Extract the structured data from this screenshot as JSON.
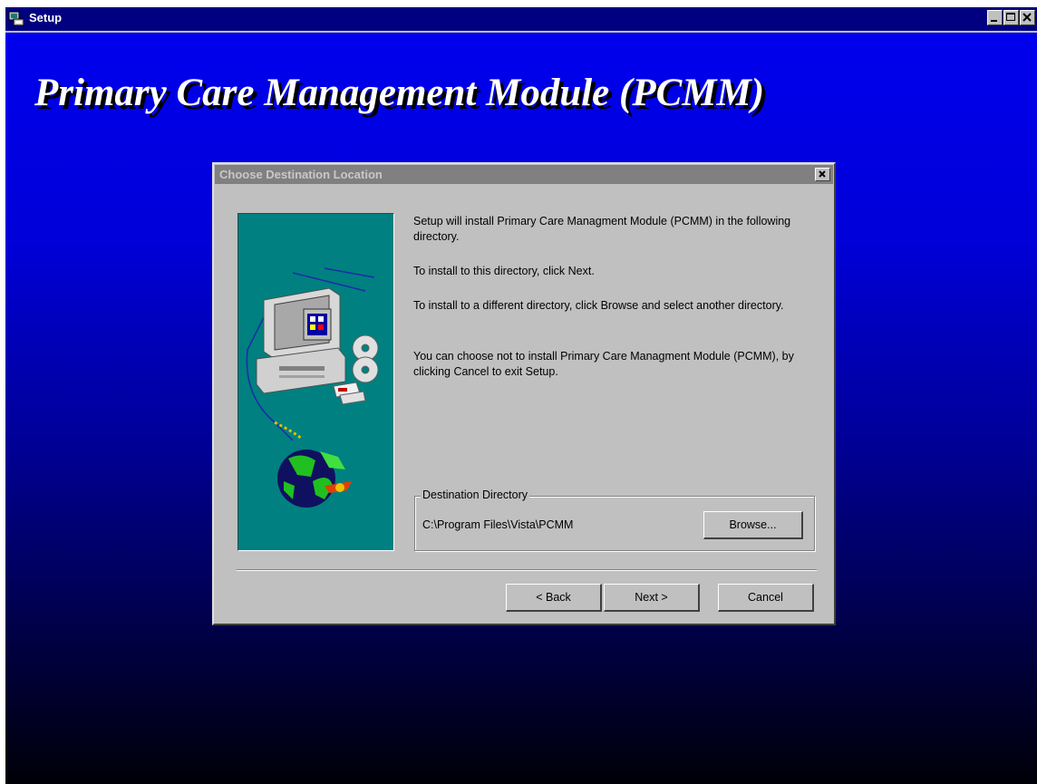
{
  "outer_window": {
    "title": "Setup",
    "banner": "Primary Care Management Module (PCMM)"
  },
  "dialog": {
    "title": "Choose Destination Location",
    "paragraphs": [
      "Setup will install Primary Care Managment Module (PCMM) in the following directory.",
      "To install to this directory, click Next.",
      "To install to a different directory, click Browse and select another directory.",
      "You can choose not to install Primary Care Managment Module (PCMM), by clicking Cancel to exit Setup."
    ],
    "destination": {
      "group_label": "Destination Directory",
      "path": "C:\\Program Files\\Vista\\PCMM",
      "browse_label": "Browse..."
    },
    "buttons": {
      "back_label": "< Back",
      "next_label": "Next >",
      "cancel_label": "Cancel"
    }
  },
  "colors": {
    "desktop_gradient_top": "#0000f0",
    "desktop_gradient_bottom": "#000008",
    "title_bar": "#000080",
    "dialog_face": "#c0c0c0",
    "art_panel": "#008080"
  },
  "icons": [
    "setup-app-icon",
    "minimize-icon",
    "maximize-icon",
    "close-icon",
    "computer-illustration",
    "cd-discs-illustration",
    "globe-illustration"
  ]
}
